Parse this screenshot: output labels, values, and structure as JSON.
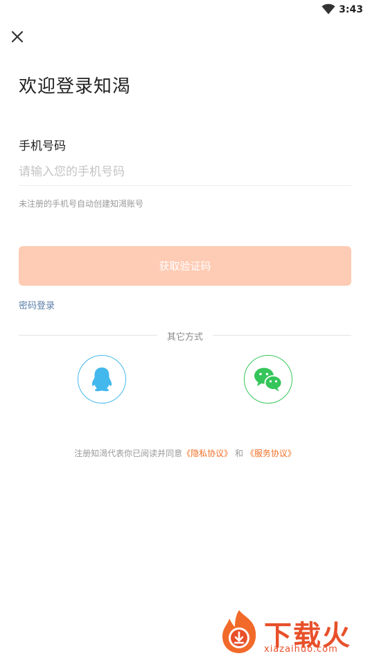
{
  "status_bar": {
    "time": "3:43",
    "wifi_icon": "wifi-icon"
  },
  "header": {
    "close_icon": "close-icon"
  },
  "title": "欢迎登录知渴",
  "phone": {
    "label": "手机号码",
    "placeholder": "请输入您的手机号码",
    "value": ""
  },
  "hint": "未注册的手机号自动创建知渴账号",
  "get_code_label": "获取验证码",
  "password_login_label": "密码登录",
  "other_methods_label": "其它方式",
  "social": [
    {
      "icon": "qq-icon",
      "color": "#43b8ec"
    },
    {
      "icon": "wechat-icon",
      "color": "#35c55a"
    }
  ],
  "agreement": {
    "prefix": "注册知渴代表你已阅读并同意",
    "privacy_link": "《隐私协议》",
    "conjunction": "和",
    "service_link": "《服务协议》"
  },
  "watermark": {
    "brand": "下载火",
    "domain": "xiazaihuo.com"
  },
  "colors": {
    "button_disabled": "#fecbb4",
    "link_blue": "#5a7ea8",
    "accent_orange": "#f07025",
    "qq_blue": "#43b8ec",
    "wechat_green": "#35c55a"
  }
}
